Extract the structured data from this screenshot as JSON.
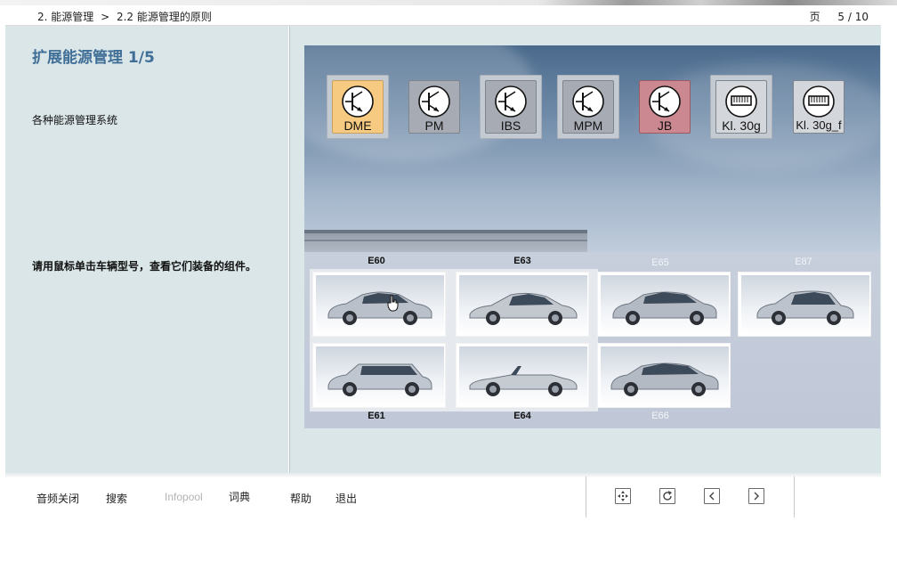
{
  "header": {
    "breadcrumb_chapter": "2. 能源管理",
    "breadcrumb_sep": ">",
    "breadcrumb_section": "2.2 能源管理的原则",
    "page_label": "页",
    "page_value": "5 / 10"
  },
  "left": {
    "title": "扩展能源管理 1/5",
    "subtitle": "各种能源管理系统",
    "instruction": "请用鼠标单击车辆型号，查看它们装备的组件。"
  },
  "controllers": [
    {
      "label": "DME",
      "icon": "transistor-icon"
    },
    {
      "label": "PM",
      "icon": "transistor-icon"
    },
    {
      "label": "IBS",
      "icon": "transistor-icon"
    },
    {
      "label": "MPM",
      "icon": "transistor-icon"
    },
    {
      "label": "JB",
      "icon": "transistor-icon"
    },
    {
      "label": "Kl. 30g",
      "icon": "relay-icon"
    },
    {
      "label": "Kl. 30g_f",
      "icon": "relay-icon"
    }
  ],
  "models": {
    "top_labels": [
      "E60",
      "E63",
      "E65",
      "E87"
    ],
    "bottom_labels": [
      "E61",
      "E64",
      "E66"
    ]
  },
  "footer": {
    "audio_off": "音频关闭",
    "search": "搜索",
    "infopool": "Infopool",
    "glossary": "词典",
    "help": "帮助",
    "exit": "退出",
    "nav_icons": [
      "navigation-map-icon",
      "refresh-icon",
      "previous-icon",
      "next-icon"
    ]
  },
  "colors": {
    "title_blue": "#3f6e96",
    "panel_bg": "#dae6e8",
    "dme_highlight": "#f7ca82",
    "jb_highlight": "#cc8891"
  }
}
